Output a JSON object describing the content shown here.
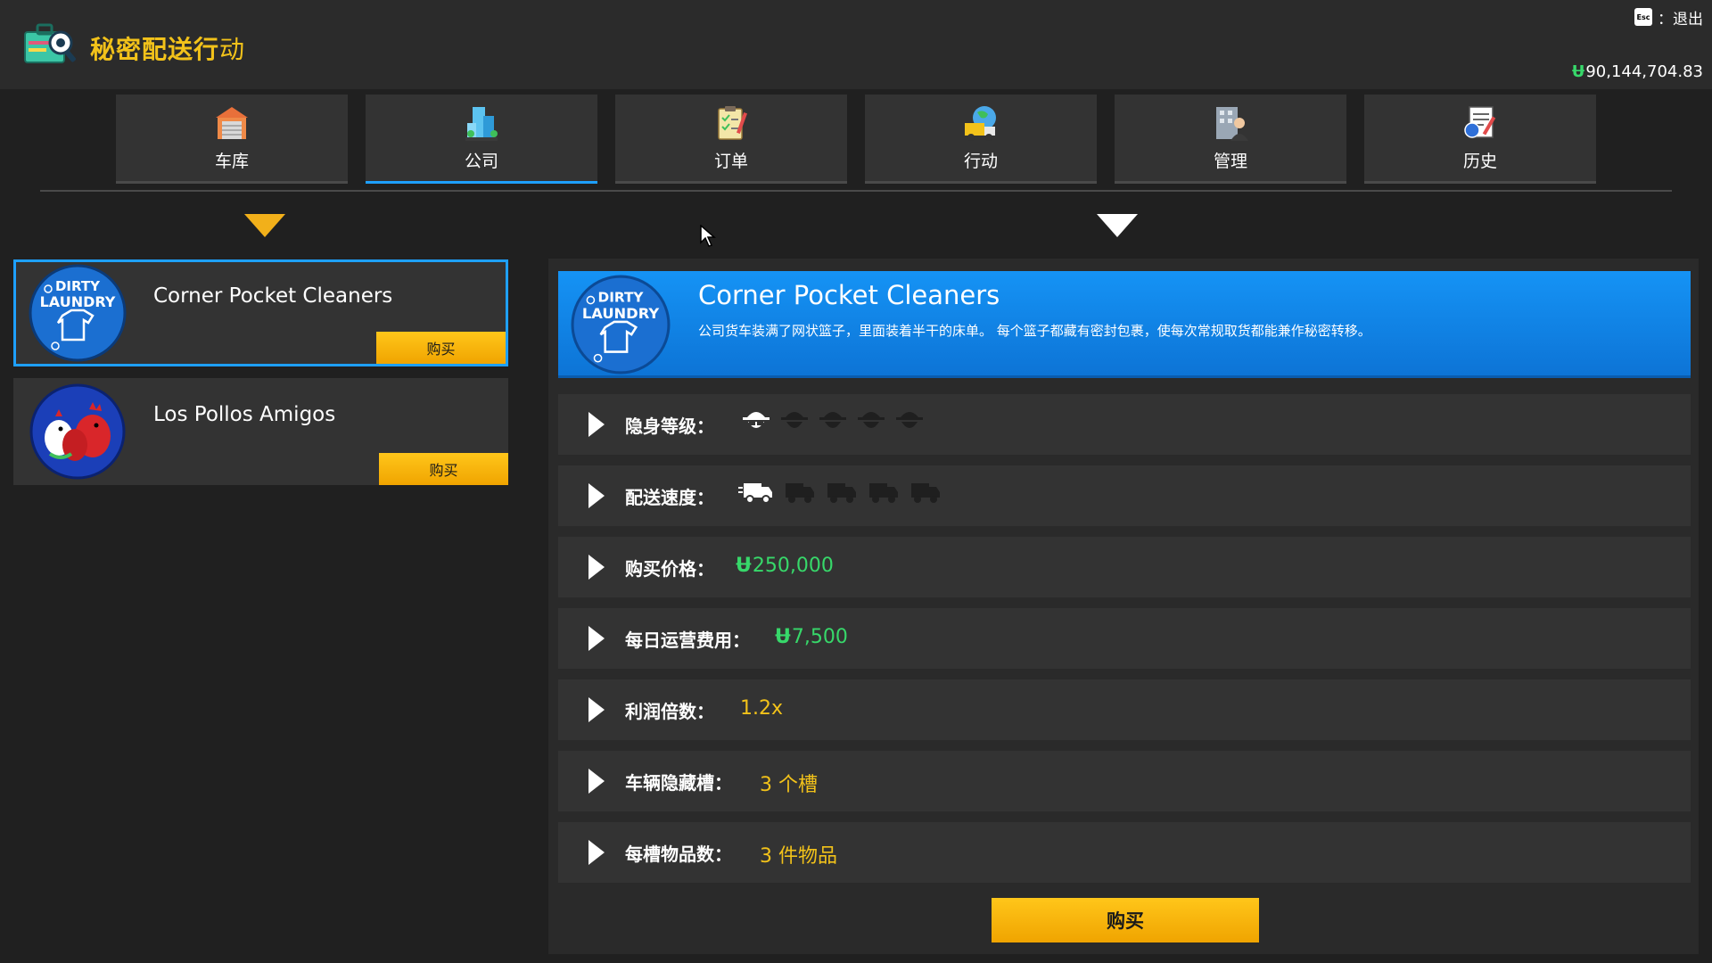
{
  "app": {
    "title_main": "秘密配送行",
    "title_tail": "动",
    "esc_key": "Esc",
    "esc_label": "：退出",
    "balance_currency": "Ʉ",
    "balance_value": "90,144,704.83"
  },
  "tabs": [
    {
      "label": "车库",
      "icon": "garage-icon"
    },
    {
      "label": "公司",
      "icon": "company-building-icon"
    },
    {
      "label": "订单",
      "icon": "order-clipboard-icon"
    },
    {
      "label": "行动",
      "icon": "operation-truck-icon"
    },
    {
      "label": "管理",
      "icon": "management-office-icon"
    },
    {
      "label": "历史",
      "icon": "history-document-icon"
    }
  ],
  "active_tab": "公司",
  "companies": [
    {
      "name": "Corner Pocket Cleaners",
      "buy_label": "购买",
      "logo": "dirty-laundry-logo",
      "logo_line1": "DIRTY",
      "logo_line2": "LAUNDRY",
      "selected": true
    },
    {
      "name": "Los Pollos Amigos",
      "buy_label": "购买",
      "logo": "chickens-logo",
      "selected": false
    }
  ],
  "detail": {
    "name": "Corner Pocket Cleaners",
    "description": "公司货车装满了网状篮子，里面装着半干的床单。 每个篮子都藏有密封包裹，使每次常规取货都能兼作秘密转移。",
    "logo_line1": "DIRTY",
    "logo_line2": "LAUNDRY",
    "stats": {
      "stealth_label": "隐身等级：",
      "stealth_level": 1,
      "stealth_max": 5,
      "speed_label": "配送速度：",
      "speed_level": 1,
      "speed_max": 5,
      "price_label": "购买价格：",
      "price_currency": "Ʉ",
      "price_value": "250,000",
      "daily_cost_label": "每日运营费用：",
      "daily_cost_currency": "Ʉ",
      "daily_cost_value": "7,500",
      "profit_label": "利润倍数：",
      "profit_value": "1.2x",
      "slots_label": "车辆隐藏槽：",
      "slots_value": "3 个槽",
      "items_label": "每槽物品数：",
      "items_value": "3 件物品"
    },
    "buy_label": "购买"
  },
  "colors": {
    "accent_blue": "#1ea0ff",
    "gold": "#f2c21a",
    "money_green": "#37d86a",
    "button_yellow": "#ffc61a"
  }
}
